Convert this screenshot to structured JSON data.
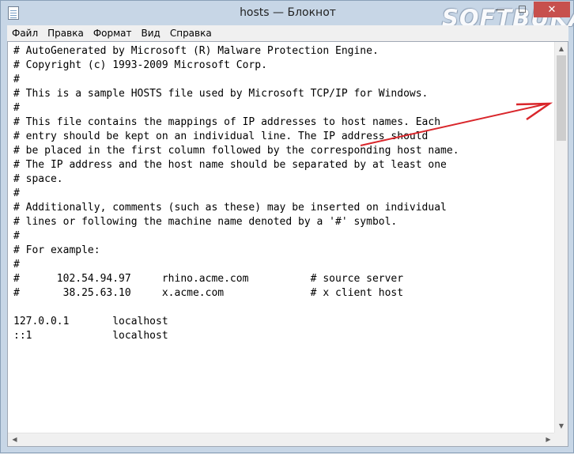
{
  "window": {
    "title": "hosts — Блокнот",
    "watermark": "SOFTBUKA",
    "buttons": {
      "minimize": "—",
      "maximize": "☐",
      "close": "✕"
    }
  },
  "menu": [
    "Файл",
    "Правка",
    "Формат",
    "Вид",
    "Справка"
  ],
  "editor": {
    "content": "# AutoGenerated by Microsoft (R) Malware Protection Engine.\n# Copyright (c) 1993-2009 Microsoft Corp.\n#\n# This is a sample HOSTS file used by Microsoft TCP/IP for Windows.\n#\n# This file contains the mappings of IP addresses to host names. Each\n# entry should be kept on an individual line. The IP address should\n# be placed in the first column followed by the corresponding host name.\n# The IP address and the host name should be separated by at least one\n# space.\n#\n# Additionally, comments (such as these) may be inserted on individual\n# lines or following the machine name denoted by a '#' symbol.\n#\n# For example:\n#\n#      102.54.94.97     rhino.acme.com          # source server\n#       38.25.63.10     x.acme.com              # x client host\n\n127.0.0.1       localhost\n::1             localhost"
  },
  "colors": {
    "title_bar": "#c7d6e6",
    "close_button": "#c7504d",
    "annotation_arrow": "#d9262b"
  },
  "icons": {
    "app": "notepad-icon",
    "scroll_up": "▲",
    "scroll_down": "▼",
    "scroll_left": "◀",
    "scroll_right": "▶"
  }
}
